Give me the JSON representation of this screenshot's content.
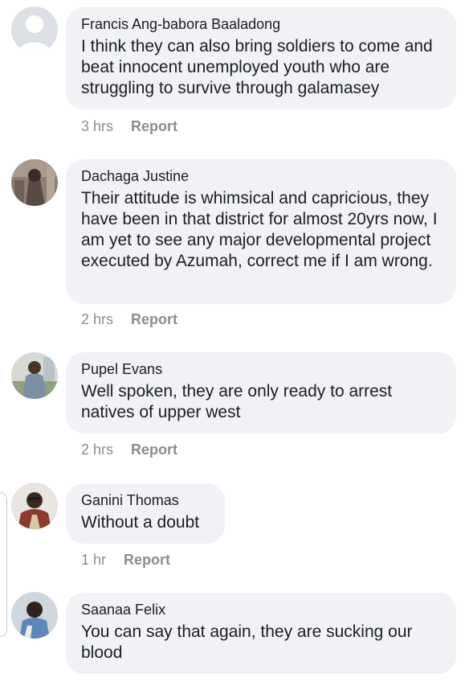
{
  "comments": [
    {
      "author": "Francis Ang-babora Baaladong",
      "text": "I think they can also bring soldiers to come and beat innocent unemployed youth who are struggling to survive through galamasey",
      "time": "3 hrs",
      "action": "Report",
      "avatar": "default-avatar"
    },
    {
      "author": "Dachaga Justine",
      "text": "Their attitude is whimsical and capricious, they have been in that district for almost 20yrs now, I am yet to see any major developmental project executed by Azumah, correct me if I am wrong.",
      "time": "2 hrs",
      "action": "Report",
      "avatar": "profile-photo"
    },
    {
      "author": "Pupel Evans",
      "text": "Well spoken, they are only ready to arrest natives of upper west",
      "time": "2 hrs",
      "action": "Report",
      "avatar": "profile-photo"
    },
    {
      "author": "Ganini Thomas",
      "text": "Without a doubt",
      "time": "1 hr",
      "action": "Report",
      "avatar": "profile-photo"
    },
    {
      "author": "Saanaa Felix",
      "text": "You can say that again, they are sucking our blood",
      "time": "",
      "action": "",
      "avatar": "profile-photo"
    }
  ]
}
